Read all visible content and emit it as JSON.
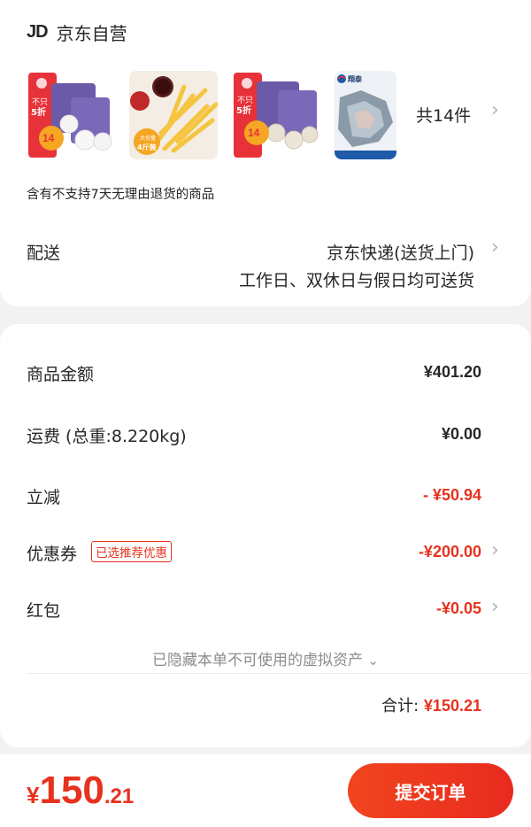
{
  "shop": {
    "logo_text": "JD",
    "name": "京东自营"
  },
  "items": {
    "count_label": "共14件",
    "thumbnails": [
      {
        "name": "fish-balls-product",
        "badge_top": "不只",
        "badge_mid": "5折",
        "badge_price": "14"
      },
      {
        "name": "french-fries-product",
        "badge_top": "大份量",
        "badge_mid": "4斤装"
      },
      {
        "name": "meatballs-product",
        "badge_top": "不只",
        "badge_mid": "5折",
        "badge_price": "14"
      },
      {
        "name": "seafood-product",
        "brand": "翔泰"
      }
    ]
  },
  "notice": "含有不支持7天无理由退货的商品",
  "delivery": {
    "label": "配送",
    "method": "京东快递(送货上门)",
    "time": "工作日、双休日与假日均可送货"
  },
  "summary": {
    "goods_label": "商品金额",
    "goods_value": "¥401.20",
    "shipping_label": "运费 (总重:8.220kg)",
    "shipping_value": "¥0.00",
    "discount_label": "立减",
    "discount_value": "- ¥50.94",
    "coupon_label": "优惠券",
    "coupon_badge": "已选推荐优惠",
    "coupon_value": "-¥200.00",
    "redpacket_label": "红包",
    "redpacket_value": "-¥0.05",
    "hidden_assets": "已隐藏本单不可使用的虚拟资产",
    "total_label": "合计:",
    "total_value": "¥150.21"
  },
  "footer": {
    "currency": "¥",
    "price_int": "150",
    "price_dec": ".21",
    "submit_label": "提交订单"
  },
  "colors": {
    "accent": "#e6321e",
    "text": "#262626",
    "muted": "#8c8c8c"
  }
}
